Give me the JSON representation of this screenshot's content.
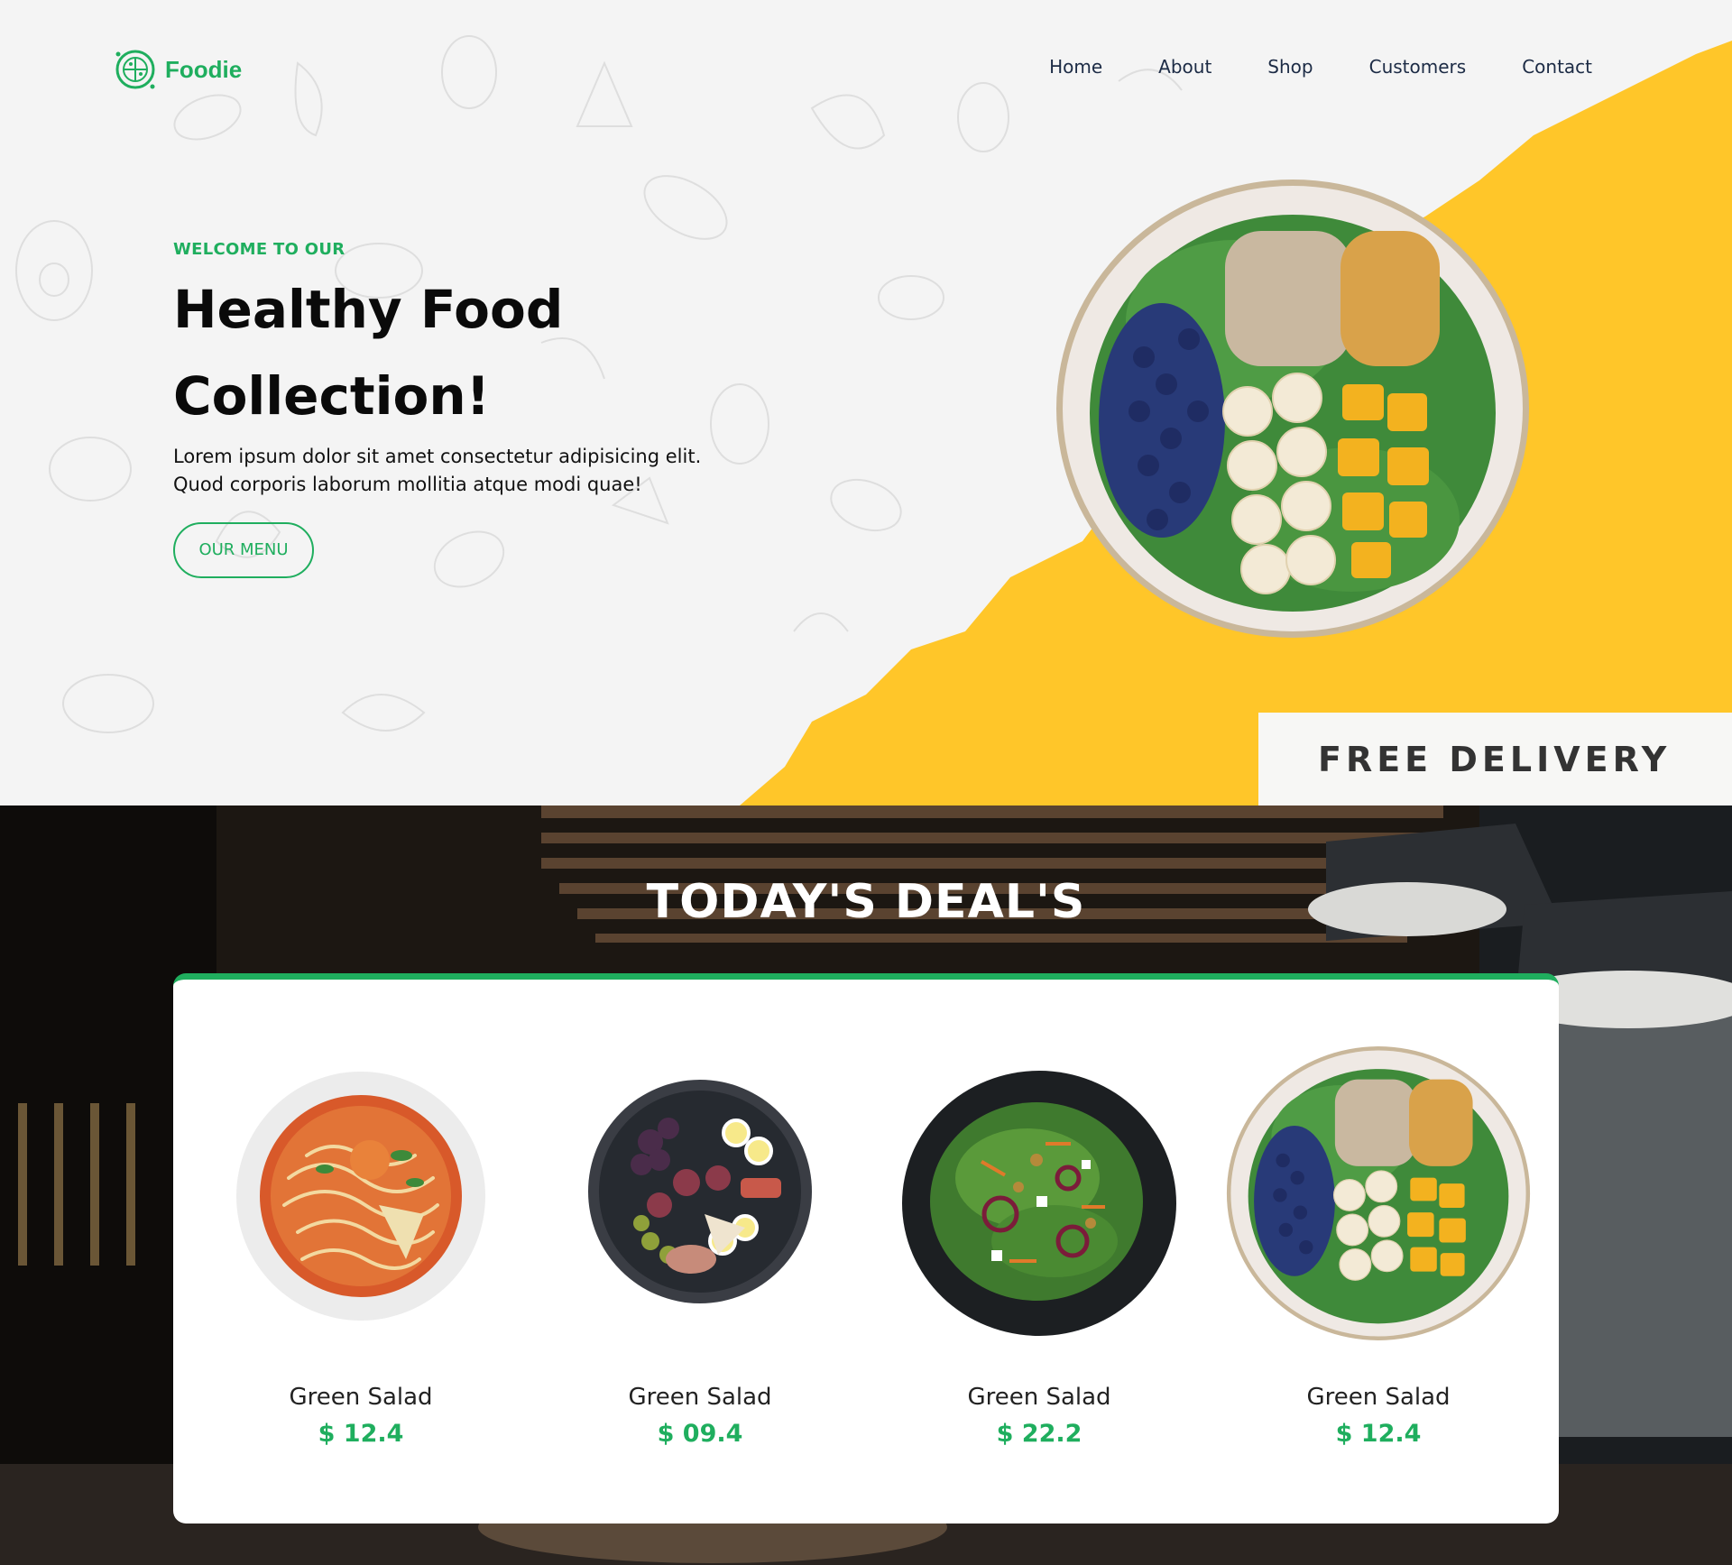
{
  "brand": {
    "name": "Foodie",
    "icon": "pizza-icon",
    "color": "#1fae5e"
  },
  "nav": [
    {
      "label": "Home"
    },
    {
      "label": "About"
    },
    {
      "label": "Shop"
    },
    {
      "label": "Customers"
    },
    {
      "label": "Contact"
    }
  ],
  "hero": {
    "welcome": "WELCOME TO OUR",
    "title": "Healthy Food Collection!",
    "description": "Lorem ipsum dolor sit amet consectetur adipisicing elit. Quod corporis laborum mollitia atque modi quae!",
    "button": "OUR MENU",
    "badge": "FREE DELIVERY",
    "accent": "#ffc629"
  },
  "deals": {
    "title": "TODAY'S DEAL'S",
    "items": [
      {
        "name": "Green Salad",
        "price": "$ 12.4",
        "image": "noodle-soup-bowl"
      },
      {
        "name": "Green Salad",
        "price": "$ 09.4",
        "image": "fig-egg-platter"
      },
      {
        "name": "Green Salad",
        "price": "$ 22.2",
        "image": "leafy-salad-dark-plate"
      },
      {
        "name": "Green Salad",
        "price": "$ 12.4",
        "image": "fruit-salad-plate"
      }
    ]
  }
}
